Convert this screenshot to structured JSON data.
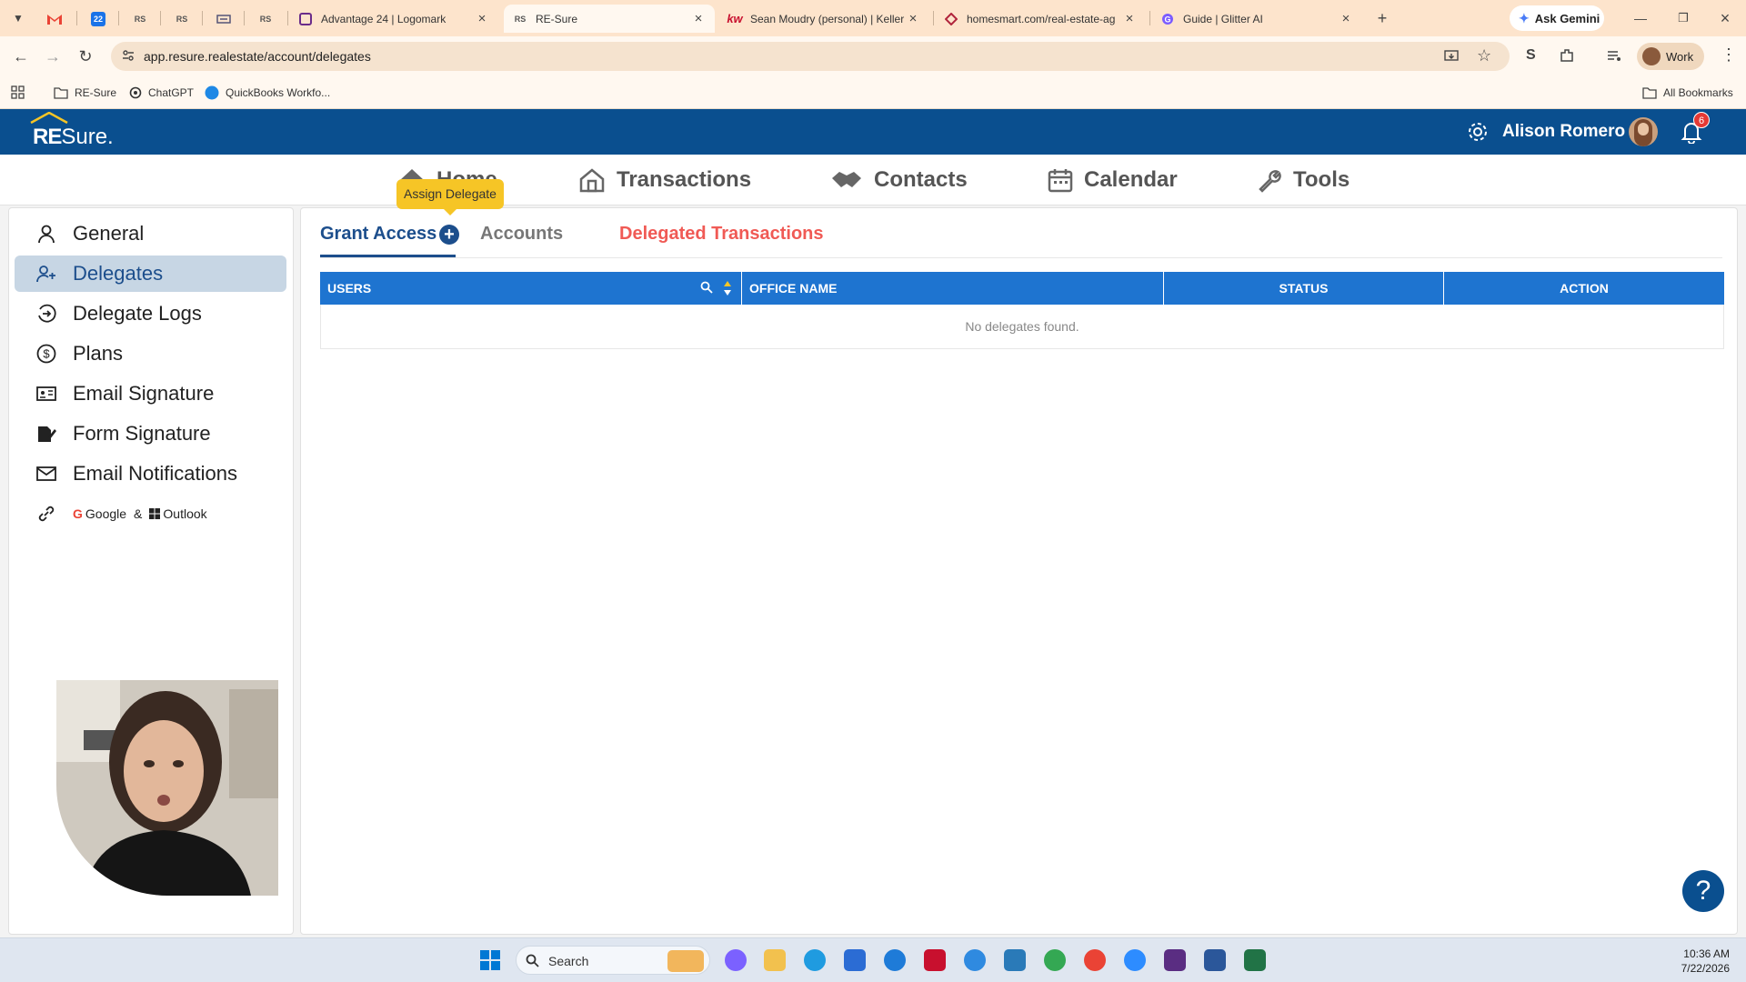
{
  "browser": {
    "tabs": [
      {
        "title": "",
        "icon": "gmail-icon",
        "pinned": true
      },
      {
        "title": "",
        "icon": "calendar-icon",
        "pinned": true
      },
      {
        "title": "",
        "icon": "resure-icon",
        "pinned": true
      },
      {
        "title": "",
        "icon": "resure-icon",
        "pinned": true
      },
      {
        "title": "",
        "icon": "site-icon",
        "pinned": true
      },
      {
        "title": "",
        "icon": "resure-icon",
        "pinned": true
      },
      {
        "title": "Advantage 24 | Logomark",
        "icon": "logomark-icon"
      },
      {
        "title": "RE-Sure",
        "icon": "resure-icon",
        "active": true
      },
      {
        "title": "Sean Moudry (personal) | Keller",
        "icon": "kw-icon"
      },
      {
        "title": "homesmart.com/real-estate-ag",
        "icon": "homesmart-icon"
      },
      {
        "title": "Guide | Glitter AI",
        "icon": "glitter-icon"
      }
    ],
    "calendar_badge": "22",
    "resure_fav": "RS",
    "kw_fav": "kw",
    "gemini_label": "Ask Gemini",
    "url": "app.resure.realestate/account/delegates",
    "profile_label": "Work",
    "bookmarks": [
      {
        "label": "RE-Sure",
        "icon": "folder-icon"
      },
      {
        "label": "ChatGPT",
        "icon": "chatgpt-icon"
      },
      {
        "label": "QuickBooks Workfo...",
        "icon": "quickbooks-icon"
      }
    ],
    "all_bookmarks": "All Bookmarks"
  },
  "app": {
    "logo_re": "RE",
    "logo_sure": "Sure.",
    "user_name": "Alison Romero",
    "notification_count": "6",
    "nav": [
      {
        "label": "Home",
        "icon": "home-icon"
      },
      {
        "label": "Transactions",
        "icon": "house-outline-icon"
      },
      {
        "label": "Contacts",
        "icon": "handshake-icon"
      },
      {
        "label": "Calendar",
        "icon": "calendar-icon"
      },
      {
        "label": "Tools",
        "icon": "wrench-icon"
      }
    ],
    "tooltip": "Assign Delegate",
    "sidebar": [
      {
        "label": "General",
        "icon": "person-icon"
      },
      {
        "label": "Delegates",
        "icon": "delegates-icon",
        "active": true
      },
      {
        "label": "Delegate Logs",
        "icon": "logs-icon"
      },
      {
        "label": "Plans",
        "icon": "dollar-icon"
      },
      {
        "label": "Email Signature",
        "icon": "id-card-icon"
      },
      {
        "label": "Form Signature",
        "icon": "signature-icon"
      },
      {
        "label": "Email Notifications",
        "icon": "mail-icon"
      }
    ],
    "integrations": {
      "google": "Google",
      "amp": "&",
      "outlook": "Outlook"
    },
    "tabs": {
      "grant": "Grant Access",
      "accounts": "Accounts",
      "delegated": "Delegated Transactions"
    },
    "table": {
      "columns": [
        "USERS",
        "OFFICE NAME",
        "STATUS",
        "ACTION"
      ],
      "empty": "No delegates found."
    },
    "help": "?"
  },
  "taskbar": {
    "search": "Search",
    "time": "10:36 AM",
    "date": "7/22/2026"
  },
  "colors": {
    "brand_blue": "#0a4f8f",
    "table_header": "#1e74d0",
    "tooltip": "#f6c526",
    "delegated_red": "#f05a55",
    "tabbar": "#fde4cc"
  }
}
